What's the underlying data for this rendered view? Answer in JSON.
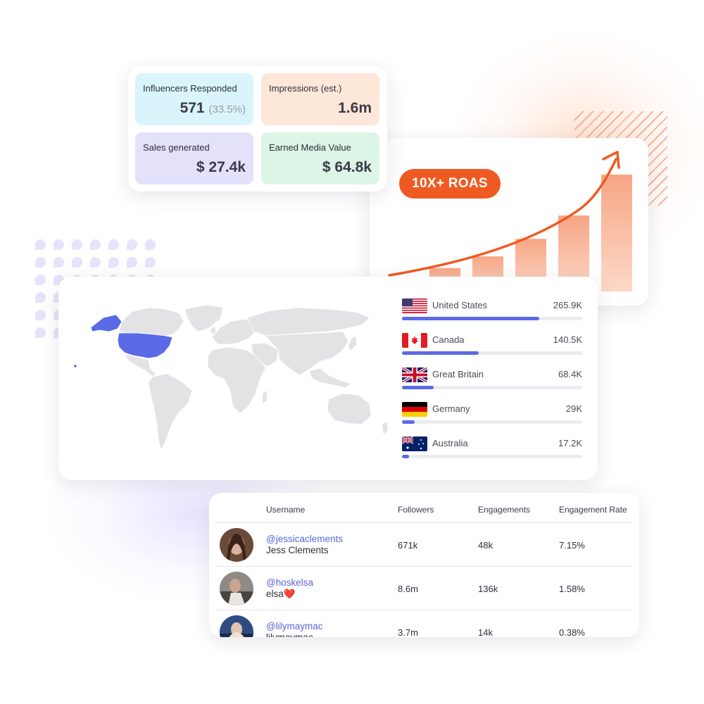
{
  "stats": {
    "influencers_label": "Influencers Responded",
    "influencers_value": "571",
    "influencers_pct": "(33.5%)",
    "impressions_label": "Impressions (est.)",
    "impressions_value": "1.6m",
    "sales_label": "Sales generated",
    "sales_value": "$ 27.4k",
    "emv_label": "Earned Media Value",
    "emv_value": "$ 64.8k"
  },
  "roas": {
    "badge": "10X+ ROAS",
    "accent": "#ef5a22",
    "bar_levels": [
      0.1,
      0.2,
      0.3,
      0.45,
      0.65,
      1.0
    ]
  },
  "countries": [
    {
      "name": "United States",
      "value": "265.9K",
      "share": 0.76,
      "flag": "us-flag"
    },
    {
      "name": "Canada",
      "value": "140.5K",
      "share": 0.425,
      "flag": "ca-flag"
    },
    {
      "name": "Great Britain",
      "value": "68.4K",
      "share": 0.175,
      "flag": "gb-flag"
    },
    {
      "name": "Germany",
      "value": "29K",
      "share": 0.07,
      "flag": "de-flag"
    },
    {
      "name": "Australia",
      "value": "17.2K",
      "share": 0.04,
      "flag": "au-flag"
    }
  ],
  "table": {
    "headers": {
      "username": "Username",
      "followers": "Followers",
      "engagements": "Engagements",
      "rate": "Engagement Rate"
    },
    "rows": [
      {
        "handle": "@jessicaclements",
        "name": "Jess Clements",
        "followers": "671k",
        "engagements": "48k",
        "rate": "7.15%"
      },
      {
        "handle": "@hoskelsa",
        "name": "elsa❤️",
        "followers": "8.6m",
        "engagements": "136k",
        "rate": "1.58%"
      },
      {
        "handle": "@lilymaymac",
        "name": "lilymaymac",
        "followers": "3.7m",
        "engagements": "14k",
        "rate": "0.38%"
      }
    ]
  },
  "colors": {
    "highlight": "#5b6ae6",
    "land": "#e3e3e6"
  }
}
